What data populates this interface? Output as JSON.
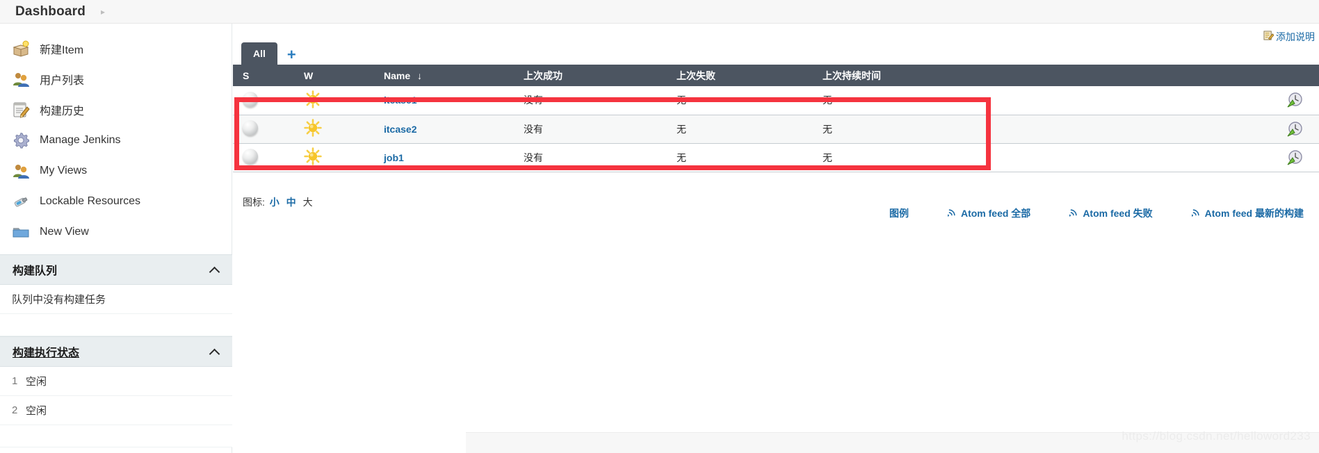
{
  "breadcrumb": {
    "root": "Dashboard",
    "separator": "▸"
  },
  "sidebar": {
    "items": [
      {
        "label": "新建Item",
        "icon": "new-item-box-icon"
      },
      {
        "label": "用户列表",
        "icon": "people-icon"
      },
      {
        "label": "构建历史",
        "icon": "notepad-pencil-icon"
      },
      {
        "label": "Manage Jenkins",
        "icon": "gear-icon"
      },
      {
        "label": "My Views",
        "icon": "people-icon"
      },
      {
        "label": "Lockable Resources",
        "icon": "usb-key-icon"
      },
      {
        "label": "New View",
        "icon": "folder-icon"
      }
    ],
    "build_queue": {
      "title": "构建队列",
      "empty_text": "队列中没有构建任务"
    },
    "build_executor": {
      "title": "构建执行状态",
      "executors": [
        {
          "num": "1",
          "status": "空闲"
        },
        {
          "num": "2",
          "status": "空闲"
        }
      ]
    }
  },
  "main": {
    "add_description": "添加说明",
    "tabs": [
      {
        "label": "All",
        "active": true
      }
    ],
    "add_tab_label": "+",
    "table": {
      "headers": [
        "S",
        "W",
        "Name",
        "上次成功",
        "上次失败",
        "上次持续时间",
        ""
      ],
      "sort_column": "Name",
      "sort_arrow": "↓",
      "rows": [
        {
          "status": "gray-ball-icon",
          "weather": "sunny-icon",
          "name": "itcase1",
          "last_success": "没有",
          "last_failure": "无",
          "last_duration": "无",
          "action": "schedule-build-icon"
        },
        {
          "status": "gray-ball-icon",
          "weather": "sunny-icon",
          "name": "itcase2",
          "last_success": "没有",
          "last_failure": "无",
          "last_duration": "无",
          "action": "schedule-build-icon"
        },
        {
          "status": "gray-ball-icon",
          "weather": "sunny-icon",
          "name": "job1",
          "last_success": "没有",
          "last_failure": "无",
          "last_duration": "无",
          "action": "schedule-build-icon"
        }
      ]
    },
    "icon_size": {
      "label": "图标:",
      "options": [
        {
          "label": "小",
          "active": true
        },
        {
          "label": "中",
          "active": true
        },
        {
          "label": "大",
          "active": false
        }
      ]
    },
    "footer_links": [
      {
        "label": "图例",
        "icon": null
      },
      {
        "label": "Atom feed 全部",
        "icon": "rss-icon"
      },
      {
        "label": "Atom feed 失败",
        "icon": "rss-icon"
      },
      {
        "label": "Atom feed 最新的构建",
        "icon": "rss-icon"
      }
    ]
  },
  "watermark": "https://blog.csdn.net/helloword233",
  "colors": {
    "header_bar": "#4c5561",
    "link": "#1b6aa5",
    "annotation": "#f5333f",
    "widget_head": "#e9eef0"
  }
}
